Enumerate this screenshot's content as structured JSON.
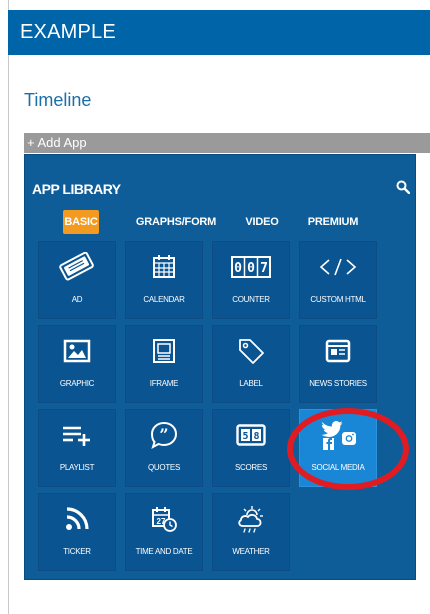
{
  "topbar": {
    "title": "EXAMPLE"
  },
  "page": {
    "title": "Timeline"
  },
  "add_app": {
    "label": "+ Add App"
  },
  "library": {
    "header": "APP LIBRARY",
    "search_icon": "search-icon",
    "tabs": [
      {
        "label": "BASIC",
        "active": true
      },
      {
        "label": "GRAPHS/FORM",
        "active": false
      },
      {
        "label": "VIDEO",
        "active": false
      },
      {
        "label": "PREMIUM",
        "active": false
      }
    ],
    "apps": [
      {
        "label": "AD",
        "icon": "ticket-icon"
      },
      {
        "label": "CALENDAR",
        "icon": "calendar-icon"
      },
      {
        "label": "COUNTER",
        "icon": "counter-icon"
      },
      {
        "label": "CUSTOM HTML",
        "icon": "code-icon"
      },
      {
        "label": "GRAPHIC",
        "icon": "image-icon"
      },
      {
        "label": "IFRAME",
        "icon": "iframe-icon"
      },
      {
        "label": "LABEL",
        "icon": "tag-icon"
      },
      {
        "label": "NEWS STORIES",
        "icon": "newspaper-icon"
      },
      {
        "label": "PLAYLIST",
        "icon": "playlist-icon"
      },
      {
        "label": "QUOTES",
        "icon": "quote-icon"
      },
      {
        "label": "SCORES",
        "icon": "scoreboard-icon"
      },
      {
        "label": "SOCIAL MEDIA",
        "icon": "social-media-icon",
        "selected": true
      },
      {
        "label": "TICKER",
        "icon": "rss-icon"
      },
      {
        "label": "TIME AND DATE",
        "icon": "calendar-clock-icon"
      },
      {
        "label": "WEATHER",
        "icon": "weather-icon"
      }
    ]
  },
  "colors": {
    "topbar": "#0064a8",
    "library_bg": "#0f5d98",
    "tile_bg": "#0a5491",
    "tab_active": "#f39a21",
    "selected_tile": "#1a86d6",
    "highlight": "#e11b22"
  }
}
